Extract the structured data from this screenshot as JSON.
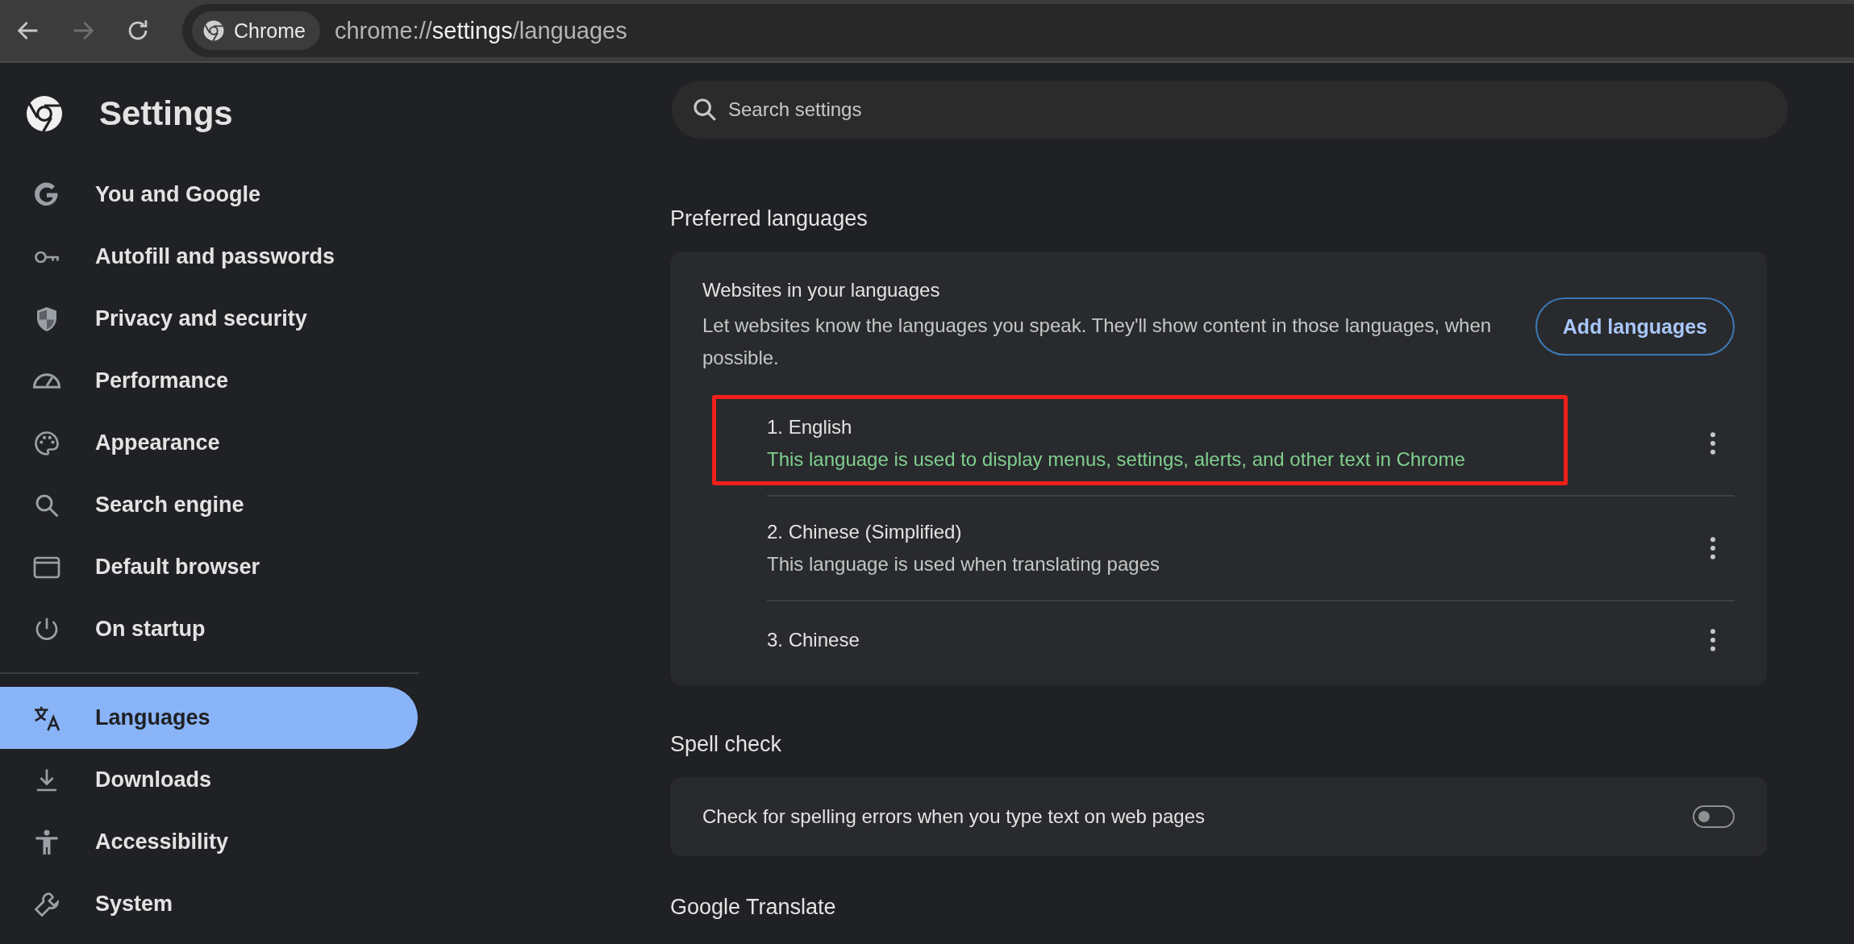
{
  "toolbar": {
    "chip_label": "Chrome",
    "url_prefix": "chrome://",
    "url_host": "settings",
    "url_path": "/languages"
  },
  "sidebar": {
    "title": "Settings",
    "groups": [
      {
        "items": [
          {
            "label": "You and Google",
            "selected": false
          },
          {
            "label": "Autofill and passwords",
            "selected": false
          },
          {
            "label": "Privacy and security",
            "selected": false
          },
          {
            "label": "Performance",
            "selected": false
          },
          {
            "label": "Appearance",
            "selected": false
          },
          {
            "label": "Search engine",
            "selected": false
          },
          {
            "label": "Default browser",
            "selected": false
          },
          {
            "label": "On startup",
            "selected": false
          }
        ]
      },
      {
        "items": [
          {
            "label": "Languages",
            "selected": true
          },
          {
            "label": "Downloads",
            "selected": false
          },
          {
            "label": "Accessibility",
            "selected": false
          },
          {
            "label": "System",
            "selected": false
          }
        ]
      }
    ]
  },
  "search": {
    "placeholder": "Search settings"
  },
  "preferred_languages": {
    "heading": "Preferred languages",
    "title": "Websites in your languages",
    "description": "Let websites know the languages you speak. They'll show content in those languages, when possible.",
    "button": "Add languages",
    "languages": [
      {
        "name": "1. English",
        "description": "This language is used to display menus, settings, alerts, and other text in Chrome",
        "kind": "display",
        "highlighted": true
      },
      {
        "name": "2. Chinese (Simplified)",
        "description": "This language is used when translating pages",
        "kind": "translation",
        "highlighted": false
      },
      {
        "name": "3. Chinese",
        "kind": "plain",
        "highlighted": false
      }
    ]
  },
  "spell_check": {
    "heading": "Spell check",
    "label": "Check for spelling errors when you type text on web pages",
    "on": false
  },
  "google_translate": {
    "heading": "Google Translate"
  }
}
